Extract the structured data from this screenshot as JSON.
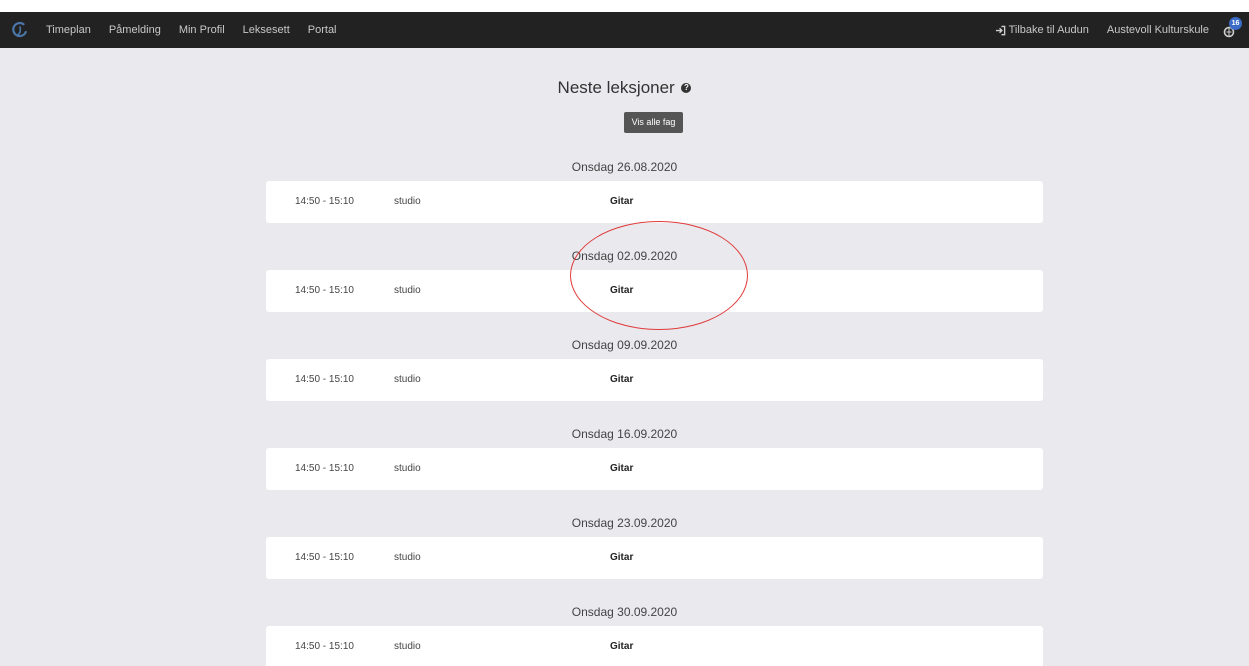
{
  "navbar": {
    "links": [
      "Timeplan",
      "Påmelding",
      "Min Profil",
      "Leksesett",
      "Portal"
    ],
    "back_label": "Tilbake til Audun",
    "org_name": "Austevoll Kulturskule",
    "notification_count": "16"
  },
  "page": {
    "title": "Neste leksjoner",
    "show_all_label": "Vis alle fag"
  },
  "days": [
    {
      "date": "Onsdag 26.08.2020",
      "time": "14:50 - 15:10",
      "room": "studio",
      "subject": "Gitar"
    },
    {
      "date": "Onsdag 02.09.2020",
      "time": "14:50 - 15:10",
      "room": "studio",
      "subject": "Gitar"
    },
    {
      "date": "Onsdag 09.09.2020",
      "time": "14:50 - 15:10",
      "room": "studio",
      "subject": "Gitar"
    },
    {
      "date": "Onsdag 16.09.2020",
      "time": "14:50 - 15:10",
      "room": "studio",
      "subject": "Gitar"
    },
    {
      "date": "Onsdag 23.09.2020",
      "time": "14:50 - 15:10",
      "room": "studio",
      "subject": "Gitar"
    },
    {
      "date": "Onsdag 30.09.2020",
      "time": "14:50 - 15:10",
      "room": "studio",
      "subject": "Gitar"
    }
  ],
  "colors": {
    "navbar_bg": "#222222",
    "page_bg": "#e9e9ee",
    "button_bg": "#555555",
    "badge_bg": "#3b6cc7",
    "annotation": "#e03a3a"
  }
}
